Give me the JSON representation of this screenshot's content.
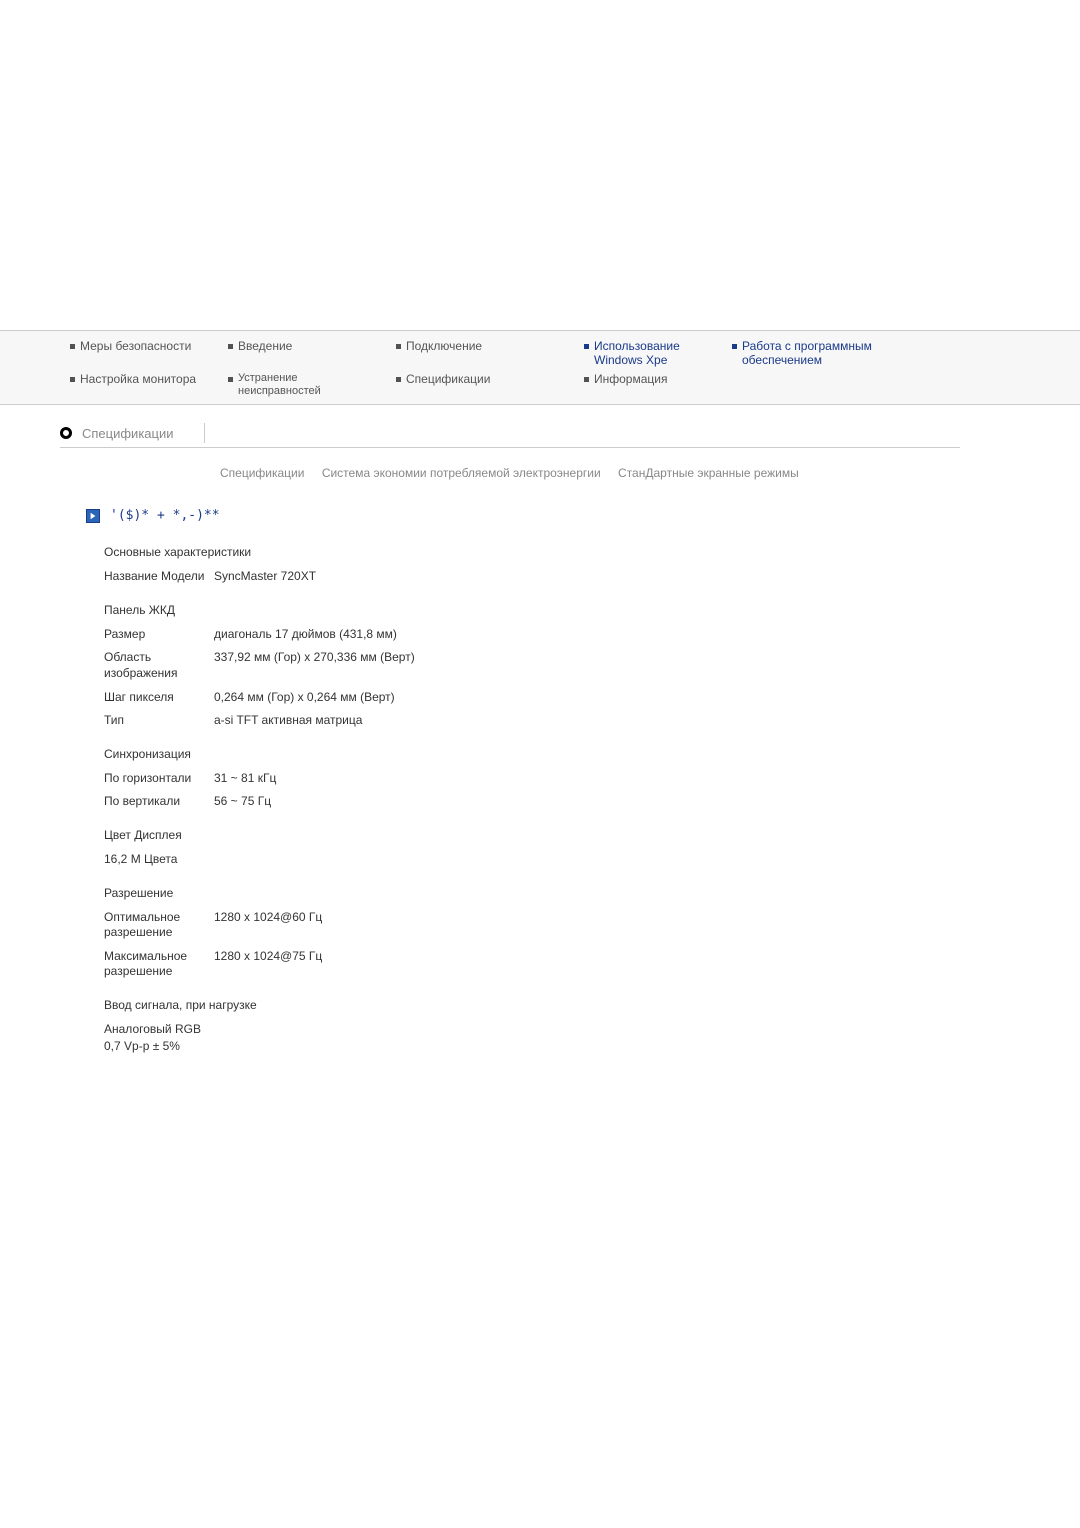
{
  "nav": {
    "row1": [
      {
        "label": "Меры безопасности",
        "blue": false
      },
      {
        "label": "Введение",
        "blue": false
      },
      {
        "label": "Подключение",
        "blue": false
      },
      {
        "label": "Использование Windows Xpe",
        "blue": true
      },
      {
        "label": "Работа с программным обеспечением",
        "blue": true
      }
    ],
    "row2": [
      {
        "label": "Настройка монитора",
        "blue": false
      },
      {
        "label": "Устранение неисправностей",
        "blue": false
      },
      {
        "label": "Спецификации",
        "blue": false
      },
      {
        "label": "Информация",
        "blue": false
      }
    ]
  },
  "section": {
    "title": "Спецификации"
  },
  "subnav": {
    "a": "Спецификации",
    "b": "Система экономии потребляемой электроэнергии",
    "c": "СтанДартные экранные режимы"
  },
  "arrow_text": "'($)*   + *,-)**",
  "spec": {
    "main_title": "Основные характеристики",
    "model_name_label": "Название Модели",
    "model_name_value": "SyncMaster 720XT",
    "panel_title": "Панель ЖКД",
    "panel": {
      "size_label": "Размер",
      "size_value": "диагональ 17 дюймов (431,8 мм)",
      "area_label": "Область изображения",
      "area_value": "337,92 мм (Гор) x 270,336 мм (Верт)",
      "pitch_label": "Шаг пикселя",
      "pitch_value": "0,264 мм (Гор) x 0,264 мм (Верт)",
      "type_label": "Тип",
      "type_value": "a-si TFT активная матрица"
    },
    "sync_title": "Синхронизация",
    "sync": {
      "h_label": "По горизонтали",
      "h_value": "31 ~ 81 кГц",
      "v_label": "По вертикали",
      "v_value": "56 ~ 75 Гц"
    },
    "color_title": "Цвет Дисплея",
    "color_value": "16,2 M Цвета",
    "res_title": "Разрешение",
    "res": {
      "opt_label": "Оптимальное разрешение",
      "opt_value": "1280 x 1024@60 Гц",
      "max_label": "Максимальное разрешение",
      "max_value": "1280 x 1024@75 Гц"
    },
    "input_title": "Ввод сигнала, при нагрузке",
    "input_line1": "Аналоговый RGB",
    "input_line2": "0,7 Vp-p ± 5%"
  }
}
